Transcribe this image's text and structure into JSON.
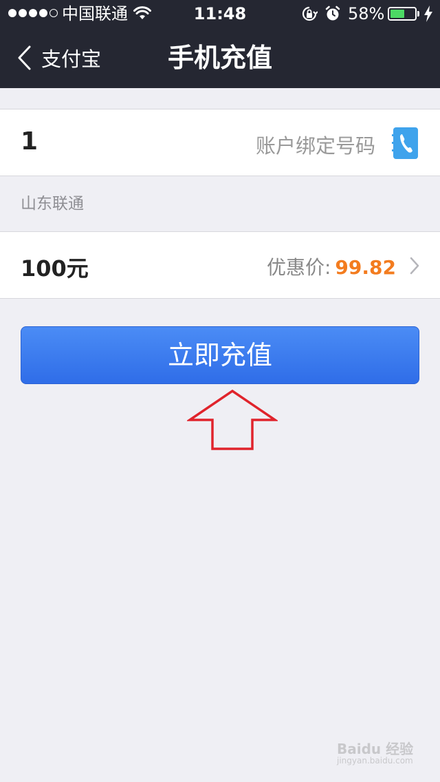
{
  "status_bar": {
    "carrier": "中国联通",
    "time": "11:48",
    "battery_percent": "58%",
    "battery_level": 0.58
  },
  "nav": {
    "back_label": "支付宝",
    "title": "手机充值"
  },
  "phone": {
    "value": "1",
    "placeholder": "账户绑定号码"
  },
  "carrier_info": "山东联通",
  "amount": {
    "value": "100元",
    "discount_label": "优惠价:",
    "discount_price": "99.82"
  },
  "cta_label": "立即充值",
  "watermark": {
    "text": "Baidu 经验",
    "sub": "jingyan.baidu.com"
  },
  "colors": {
    "nav_bg": "#252732",
    "accent_blue": "#3a7af0",
    "price_orange": "#f37c1f",
    "annotation_red": "#e0242c"
  }
}
